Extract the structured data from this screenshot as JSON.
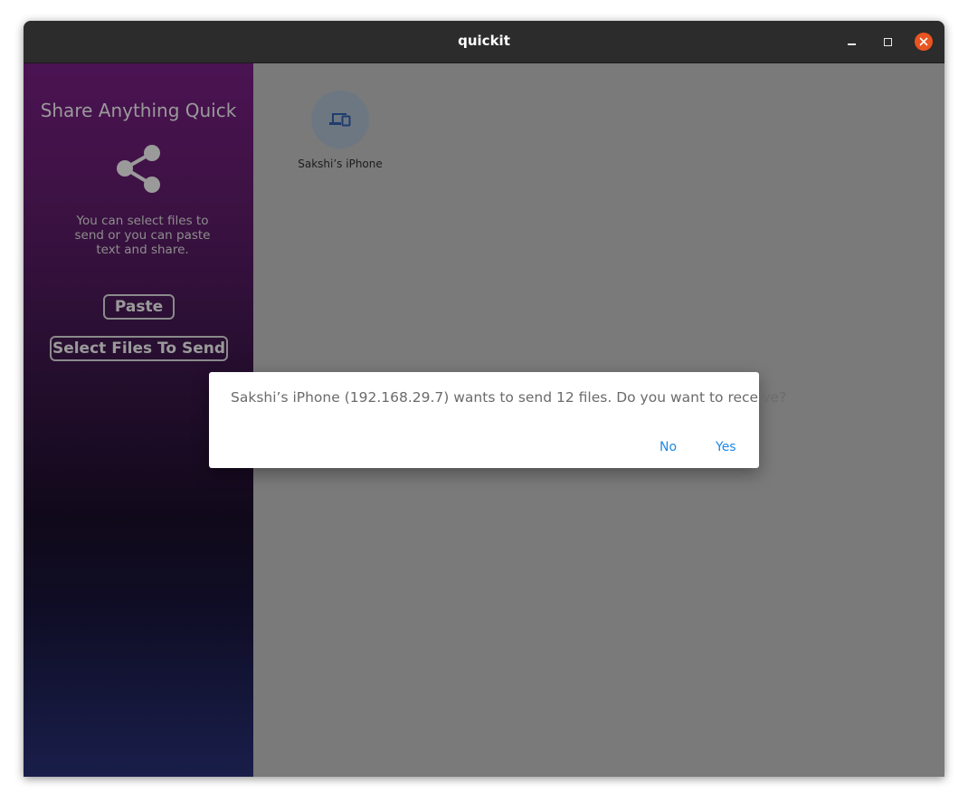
{
  "window": {
    "title": "quickit",
    "controls": {
      "minimize": "minimize-icon",
      "maximize": "maximize-icon",
      "close": "close-icon"
    }
  },
  "sidebar": {
    "title": "Share Anything Quick",
    "icon": "share-icon",
    "description": "You can select files to send or you can paste text and share.",
    "paste_label": "Paste",
    "select_files_label": "Select Files To Send"
  },
  "devices": [
    {
      "name": "Sakshi’s iPhone",
      "icon": "devices-icon"
    }
  ],
  "dialog": {
    "message": "Sakshi’s iPhone (192.168.29.7) wants to send 12 files. Do you want to receive?",
    "no_label": "No",
    "yes_label": "Yes"
  },
  "colors": {
    "accent": "#1e88e5",
    "close_button": "#e95420",
    "titlebar": "#2c2c2c",
    "overlay": "#7a7a7a"
  }
}
